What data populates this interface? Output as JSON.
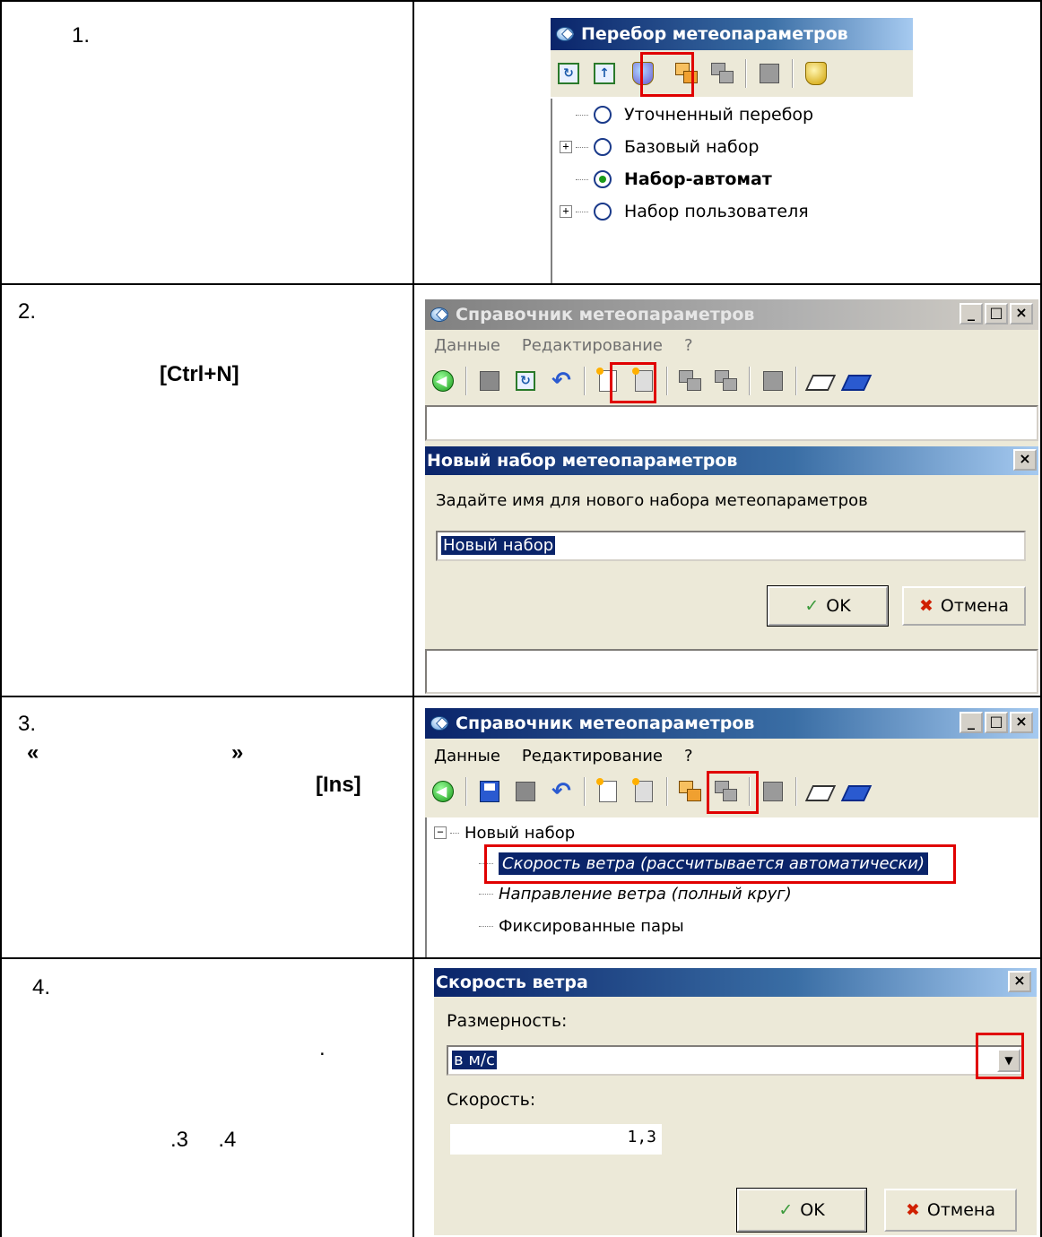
{
  "rows": [
    {
      "number": "1."
    },
    {
      "number": "2.",
      "shortcut": "[Ctrl+N]"
    },
    {
      "number": "3.",
      "quote_open": "«",
      "quote_close": "»",
      "shortcut": "[Ins]"
    },
    {
      "number": "4.",
      "dot": ".",
      "refs": ".3     .4"
    }
  ],
  "panel1": {
    "title": "Перебор метеопараметров",
    "tree": [
      {
        "label": "Уточненный перебор",
        "selected": false,
        "expandable": false
      },
      {
        "label": "Базовый набор",
        "selected": false,
        "expandable": true
      },
      {
        "label": "Набор-автомат",
        "selected": true,
        "expandable": false
      },
      {
        "label": "Набор пользователя",
        "selected": false,
        "expandable": true
      }
    ]
  },
  "panel2": {
    "title": "Справочник метеопараметров",
    "menu": [
      "Данные",
      "Редактирование",
      "?"
    ],
    "dialog": {
      "title": "Новый набор метеопараметров",
      "prompt": "Задайте имя для нового набора метеопараметров",
      "value": "Новый набор",
      "ok": "OK",
      "cancel": "Отмена"
    }
  },
  "panel3": {
    "title": "Справочник метеопараметров",
    "menu": [
      "Данные",
      "Редактирование",
      "?"
    ],
    "tree_root": "Новый набор",
    "tree_items": [
      "Скорость ветра (рассчитывается автоматически)",
      "Направление ветра (полный круг)",
      "Фиксированные пары"
    ]
  },
  "panel4": {
    "title": "Скорость ветра",
    "dimension_label": "Размерность:",
    "dimension_value": "в м/с",
    "speed_label": "Скорость:",
    "speed_value": "1,3",
    "ok": "OK",
    "cancel": "Отмена"
  },
  "window_buttons": {
    "minimize": "_",
    "maximize": "□",
    "close": "×"
  },
  "colors": {
    "highlight": "#e00000",
    "titlebar": "#0a246a"
  }
}
